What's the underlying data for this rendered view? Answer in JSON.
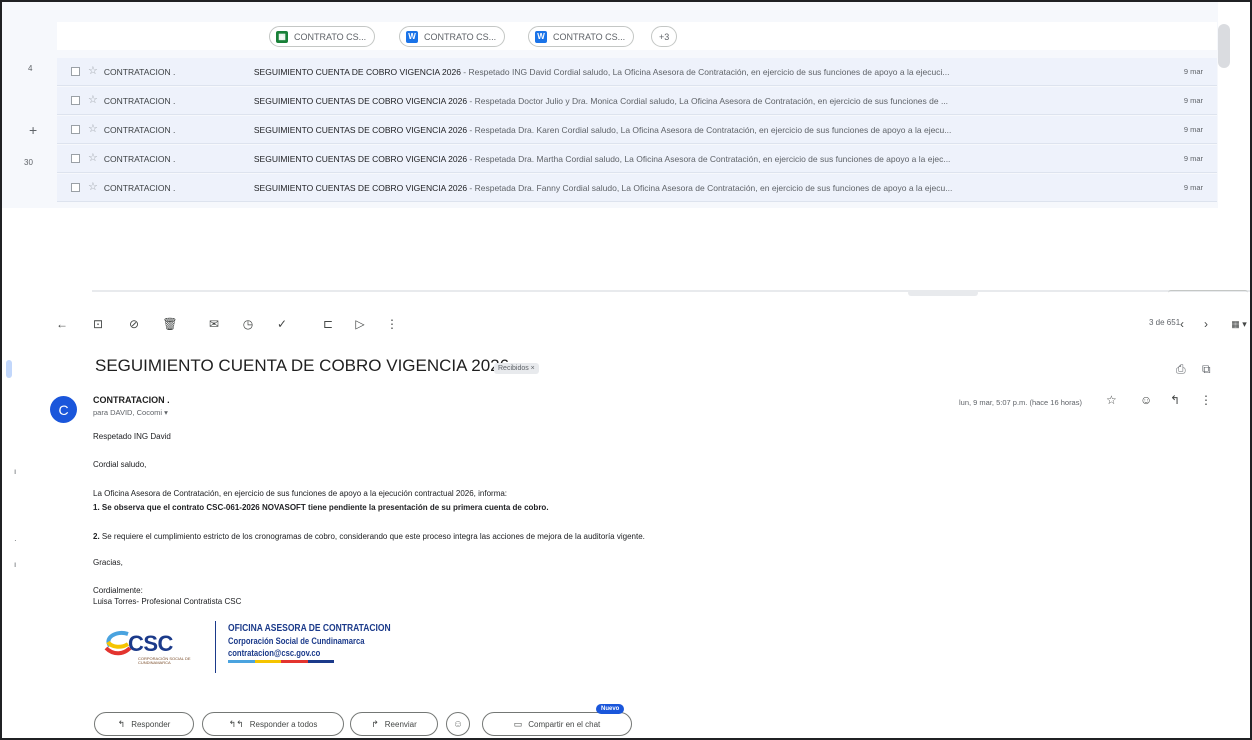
{
  "attachments": [
    {
      "label": "CONTRATO CS...",
      "icon": "sheets-icon",
      "color": "#188038"
    },
    {
      "label": "CONTRATO CS...",
      "icon": "docs-icon",
      "color": "#1a73e8"
    },
    {
      "label": "CONTRATO CS...",
      "icon": "docs-icon",
      "color": "#1a73e8"
    }
  ],
  "attachments_more": "+3",
  "side": {
    "n1": "4",
    "n2": "30",
    "plus": "+"
  },
  "emails": [
    {
      "sender": "CONTRATACION .",
      "subject": "SEGUIMIENTO CUENTA DE COBRO VIGENCIA 2026",
      "snippet": " - Respetado ING David Cordial saludo, La Oficina Asesora de Contratación, en ejercicio de sus funciones de apoyo a la ejecuci...",
      "date": "9 mar"
    },
    {
      "sender": "CONTRATACION .",
      "subject": "SEGUIMIENTO CUENTAS DE COBRO VIGENCIA 2026",
      "snippet": " - Respetada Doctor Julio y Dra. Monica Cordial saludo, La Oficina Asesora de Contratación, en ejercicio de sus funciones de ...",
      "date": "9 mar"
    },
    {
      "sender": "CONTRATACION .",
      "subject": "SEGUIMIENTO CUENTAS DE COBRO VIGENCIA 2026",
      "snippet": " - Respetada Dra. Karen Cordial saludo, La Oficina Asesora de Contratación, en ejercicio de sus funciones de apoyo a la ejecu...",
      "date": "9 mar"
    },
    {
      "sender": "CONTRATACION .",
      "subject": "SEGUIMIENTO CUENTAS DE COBRO VIGENCIA 2026",
      "snippet": " - Respetada Dra. Martha Cordial saludo, La Oficina Asesora de Contratación, en ejercicio de sus funciones de apoyo a la ejec...",
      "date": "9 mar"
    },
    {
      "sender": "CONTRATACION .",
      "subject": "SEGUIMIENTO CUENTAS DE COBRO VIGENCIA 2026",
      "snippet": " - Respetada Dra. Fanny Cordial saludo, La Oficina Asesora de Contratación, en ejercicio de sus funciones de apoyo a la ejecu...",
      "date": "9 mar"
    }
  ],
  "toolbar": {
    "icons": [
      "back-arrow-icon",
      "archive-icon",
      "report-spam-icon",
      "delete-icon",
      "mark-unread-icon",
      "snooze-icon",
      "add-task-icon",
      "move-to-icon",
      "label-icon",
      "more-vert-icon"
    ],
    "glyphs": [
      "←",
      "⊡",
      "⊘",
      "🗑",
      "✉",
      "◷",
      "✓",
      "⊏",
      "▷",
      "⋮"
    ],
    "pager": "3 de 651",
    "prev": "‹",
    "next": "›",
    "input_tools": "▦ ▾"
  },
  "message": {
    "subject": "SEGUIMIENTO CUENTA DE COBRO VIGENCIA 2026",
    "label": "Recibidos ×",
    "avatar_letter": "C",
    "from": "CONTRATACION .",
    "to": "para DAVID, Cocomi ▾",
    "date": "lun, 9 mar, 5:07 p.m. (hace 16 horas)",
    "greeting": "Respetado ING David",
    "salutation": "Cordial saludo,",
    "intro": "La Oficina Asesora de Contratación, en ejercicio de sus funciones de apoyo a la ejecución contractual 2026, informa:",
    "point1": "1. Se observa que el contrato CSC-061-2026 NOVASOFT tiene pendiente la presentación de su primera cuenta de cobro.",
    "point2_num": "2.",
    "point2": " Se requiere el cumplimiento estricto de los cronogramas de cobro, considerando que este proceso integra las acciones de mejora de la auditoría vigente.",
    "thanks": "Gracias,",
    "closing": "Cordialmente:",
    "signer": "Luisa Torres- Profesional Contratista CSC"
  },
  "signature": {
    "logo_text": "CSC",
    "logo_sub": "CORPORACIÓN SOCIAL DE CUNDINAMARCA",
    "line1": "OFICINA ASESORA DE CONTRATACION",
    "line2": "Corporación Social de Cundinamarca",
    "line3": "contratacion@csc.gov.co",
    "bar_colors": [
      "#4aa3df",
      "#f5c400",
      "#e3342f",
      "#1b3a8a"
    ]
  },
  "actions": {
    "reply": "Responder",
    "reply_all": "Responder a todos",
    "forward": "Reenviar",
    "share_chat": "Compartir en el chat",
    "new_badge": "Nuevo"
  },
  "accent": "#1a56db"
}
